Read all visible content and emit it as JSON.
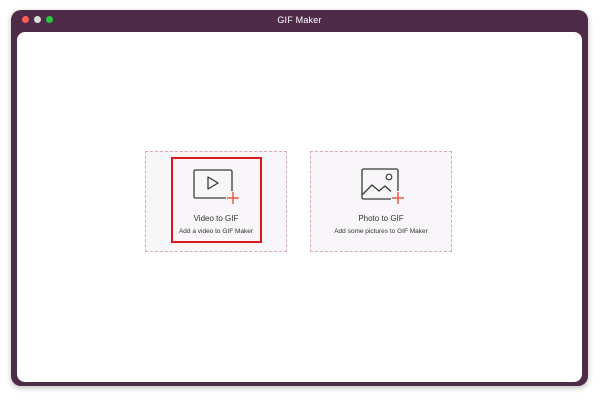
{
  "window": {
    "title": "GIF Maker"
  },
  "cards": [
    {
      "id": "video",
      "title": "Video to GIF",
      "subtitle": "Add a video to GIF Maker",
      "icon": "video-play-add-icon",
      "highlighted": true
    },
    {
      "id": "photo",
      "title": "Photo to GIF",
      "subtitle": "Add some pictures to GIF Maker",
      "icon": "image-add-icon",
      "highlighted": false
    }
  ],
  "colors": {
    "window_frame": "#4e2b48",
    "card_background": "#f8f6f8",
    "card_dashed_border": "#d6a9c2",
    "highlight": "#e0151e",
    "icon_stroke": "#3a3a3a",
    "plus_accent": "#e4553a"
  }
}
